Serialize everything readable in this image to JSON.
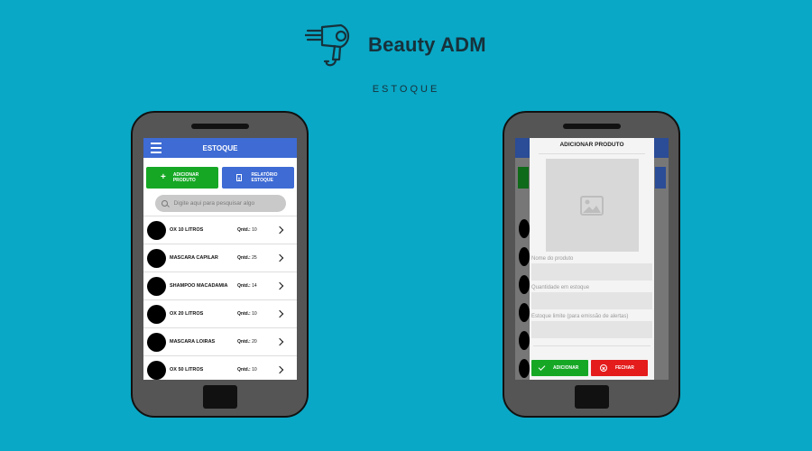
{
  "header": {
    "brand": "Beauty ADM",
    "subtitle": "ESTOQUE"
  },
  "icons": {
    "logo": "hair-dryer-icon",
    "menu": "hamburger-menu-icon",
    "add": "plus-icon",
    "report": "document-icon",
    "search": "search-icon",
    "row_arrow": "chevron-right-icon",
    "image_placeholder": "image-icon",
    "confirm": "check-icon",
    "close": "close-circle-icon"
  },
  "colors": {
    "background": "#09a8c6",
    "appbar": "#3e6bd4",
    "green": "#16a825",
    "red": "#e41c1c"
  },
  "left_screen": {
    "title": "ESTOQUE",
    "add_button": {
      "line1": "ADICIONAR",
      "line2": "PRODUTO"
    },
    "report_button": {
      "line1": "RELATÓRIO",
      "line2": "ESTOQUE"
    },
    "search": {
      "placeholder": "Digite aqui para pesquisar algo"
    },
    "qty_label": "Qntd.:",
    "items": [
      {
        "name": "OX 10 LITROS",
        "qty": "10"
      },
      {
        "name": "MASCARA CAPILAR",
        "qty": "25"
      },
      {
        "name": "SHAMPOO MACADAMIA",
        "qty": "14"
      },
      {
        "name": "OX 20 LITROS",
        "qty": "10"
      },
      {
        "name": "MASCARA LOIRAS",
        "qty": "20"
      },
      {
        "name": "OX 50 LITROS",
        "qty": "10"
      }
    ]
  },
  "right_screen": {
    "modal_title": "ADICIONAR PRODUTO",
    "fields": [
      {
        "label": "Nome do produto",
        "value": ""
      },
      {
        "label": "Quantidade em estoque",
        "value": ""
      },
      {
        "label": "Estoque limite (para emissão de alertas)",
        "value": ""
      }
    ],
    "add_label": "ADICIONAR",
    "close_label": "FECHAR"
  }
}
